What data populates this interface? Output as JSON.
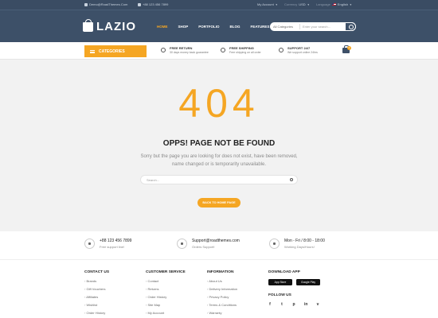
{
  "topbar": {
    "email": "Demo@RoadThemes.Com",
    "phone": "+88 123 456 7899",
    "account": "My Account",
    "currency_label": "Currency",
    "currency_value": "USD",
    "language_label": "Language",
    "language_value": "English"
  },
  "logo": {
    "text": "LAZIO"
  },
  "nav": [
    {
      "label": "HOME"
    },
    {
      "label": "SHOP"
    },
    {
      "label": "PORTFOLIO"
    },
    {
      "label": "BLOG"
    },
    {
      "label": "FEATURES"
    }
  ],
  "search": {
    "category": "All Categories",
    "placeholder": "Enter your search..."
  },
  "categories_button": "CATEGORIES",
  "features": [
    {
      "title": "FREE RETURN",
      "subtitle": "30 days money back guarantee"
    },
    {
      "title": "FREE SHIPPING",
      "subtitle": "Free shipping on all order"
    },
    {
      "title": "SUPPORT 24/7",
      "subtitle": "We support online 24hrs"
    }
  ],
  "cart": {
    "count": "0"
  },
  "error": {
    "code": "404",
    "headline": "OPPS! PAGE NOT BE FOUND",
    "description": "Sorry but the page you are looking for does not exist, have been removed, name changed or is temporarity unavailable.",
    "search_placeholder": "Search...",
    "home_button": "BACK TO HOME PAGE"
  },
  "contacts": [
    {
      "title": "+88 123 456 7899",
      "subtitle": "Free support line!"
    },
    {
      "title": "Support@roadthemes.com",
      "subtitle": "Orders Support!"
    },
    {
      "title": "Mon - Fri / 8:00 - 18:00",
      "subtitle": "Working Days/Hours!"
    }
  ],
  "footer": {
    "contact_us": {
      "title": "CONTACT US",
      "links": [
        "Brands",
        "Gift Vouchers",
        "Affiliates",
        "Wishlist",
        "Order History"
      ]
    },
    "customer_service": {
      "title": "CUSTOMER SERVICE",
      "links": [
        "Contact",
        "Returns",
        "Order History",
        "Site Map",
        "My Account"
      ]
    },
    "information": {
      "title": "INFORMATION",
      "links": [
        "About Us",
        "Delivery Information",
        "Privacy Policy",
        "Terms & Conditions",
        "Warranty"
      ]
    },
    "download_app": {
      "title": "DOWNLOAD APP",
      "badges": [
        "App Store",
        "Google Play"
      ]
    },
    "follow_us": {
      "title": "FOLLOW US",
      "icons": [
        "f",
        "t",
        "p",
        "in",
        "v"
      ]
    }
  },
  "colors": {
    "header": "#3d5068",
    "accent": "#f5a623",
    "main_bg": "#f2f2f2"
  }
}
